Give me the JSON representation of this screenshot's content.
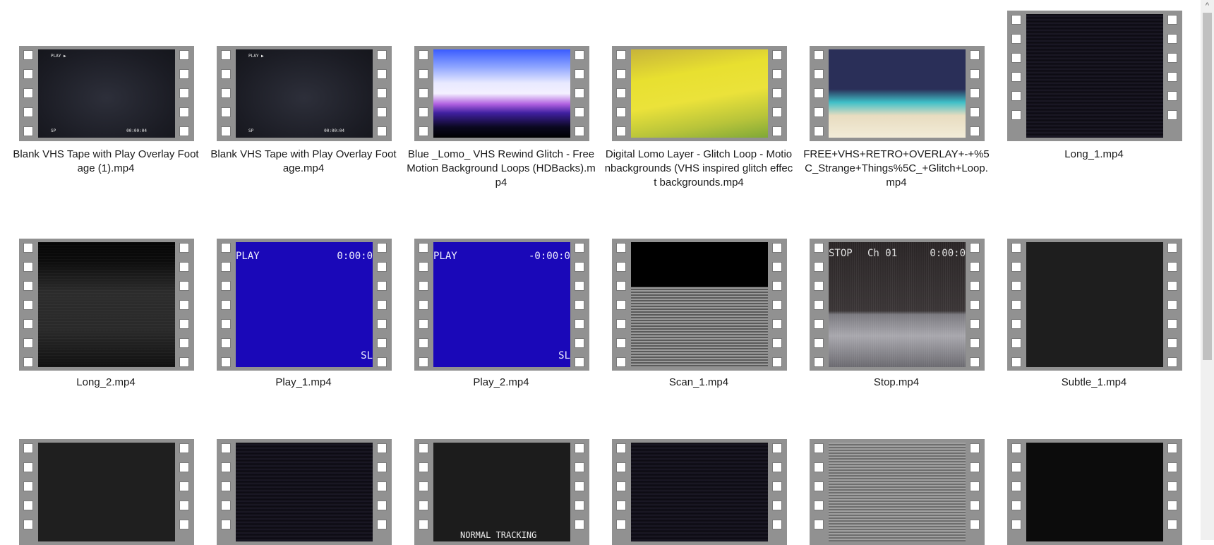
{
  "files": [
    {
      "name": "Blank VHS Tape with Play Overlay Footage (1).mp4",
      "style": "vhs-blank",
      "osd": {
        "tl": "PLAY ▶",
        "bl": "SP",
        "br": "00:00:04"
      }
    },
    {
      "name": "Blank VHS Tape with Play Overlay Footage.mp4",
      "style": "vhs-blank",
      "osd": {
        "tl": "PLAY ▶",
        "bl": "SP",
        "br": "00:00:04"
      }
    },
    {
      "name": "Blue _Lomo_ VHS Rewind Glitch - Free Motion Background Loops (HDBacks).mp4",
      "style": "blue-lomo"
    },
    {
      "name": "Digital Lomo Layer - Glitch Loop - Motionbackgrounds (VHS inspired glitch effect backgrounds.mp4",
      "style": "yellow-lomo"
    },
    {
      "name": "FREE+VHS+RETRO+OVERLAY+-+%5C_Strange+Things%5C_+Glitch+Loop.mp4",
      "style": "teal-glow"
    },
    {
      "name": "Long_1.mp4",
      "style": "static-dark"
    },
    {
      "name": "Long_2.mp4",
      "style": "dark-gradient"
    },
    {
      "name": "Play_1.mp4",
      "style": "blue-play",
      "osd": {
        "tl": "PLAY",
        "tr": "0:00:0",
        "br": "SL"
      }
    },
    {
      "name": "Play_2.mp4",
      "style": "blue-play",
      "osd": {
        "tl": "PLAY",
        "tr": "-0:00:0",
        "br": "SL"
      }
    },
    {
      "name": "Scan_1.mp4",
      "style": "scan"
    },
    {
      "name": "Stop.mp4",
      "style": "stop-noise",
      "osd": {
        "tl": "STOP",
        "tc": "Ch 01",
        "tr": "0:00:0"
      }
    },
    {
      "name": "Subtle_1.mp4",
      "style": "plain-dark"
    },
    {
      "name": "",
      "style": "plain-dark2"
    },
    {
      "name": "",
      "style": "static-dark"
    },
    {
      "name": "",
      "style": "tracking",
      "osd": {
        "bc": "NORMAL TRACKING"
      }
    },
    {
      "name": "",
      "style": "static-dark"
    },
    {
      "name": "",
      "style": "gray-lines"
    },
    {
      "name": "",
      "style": "black"
    }
  ],
  "icons": {
    "scroll_up": "chevron-up-icon"
  },
  "scroll_up_glyph": "^"
}
